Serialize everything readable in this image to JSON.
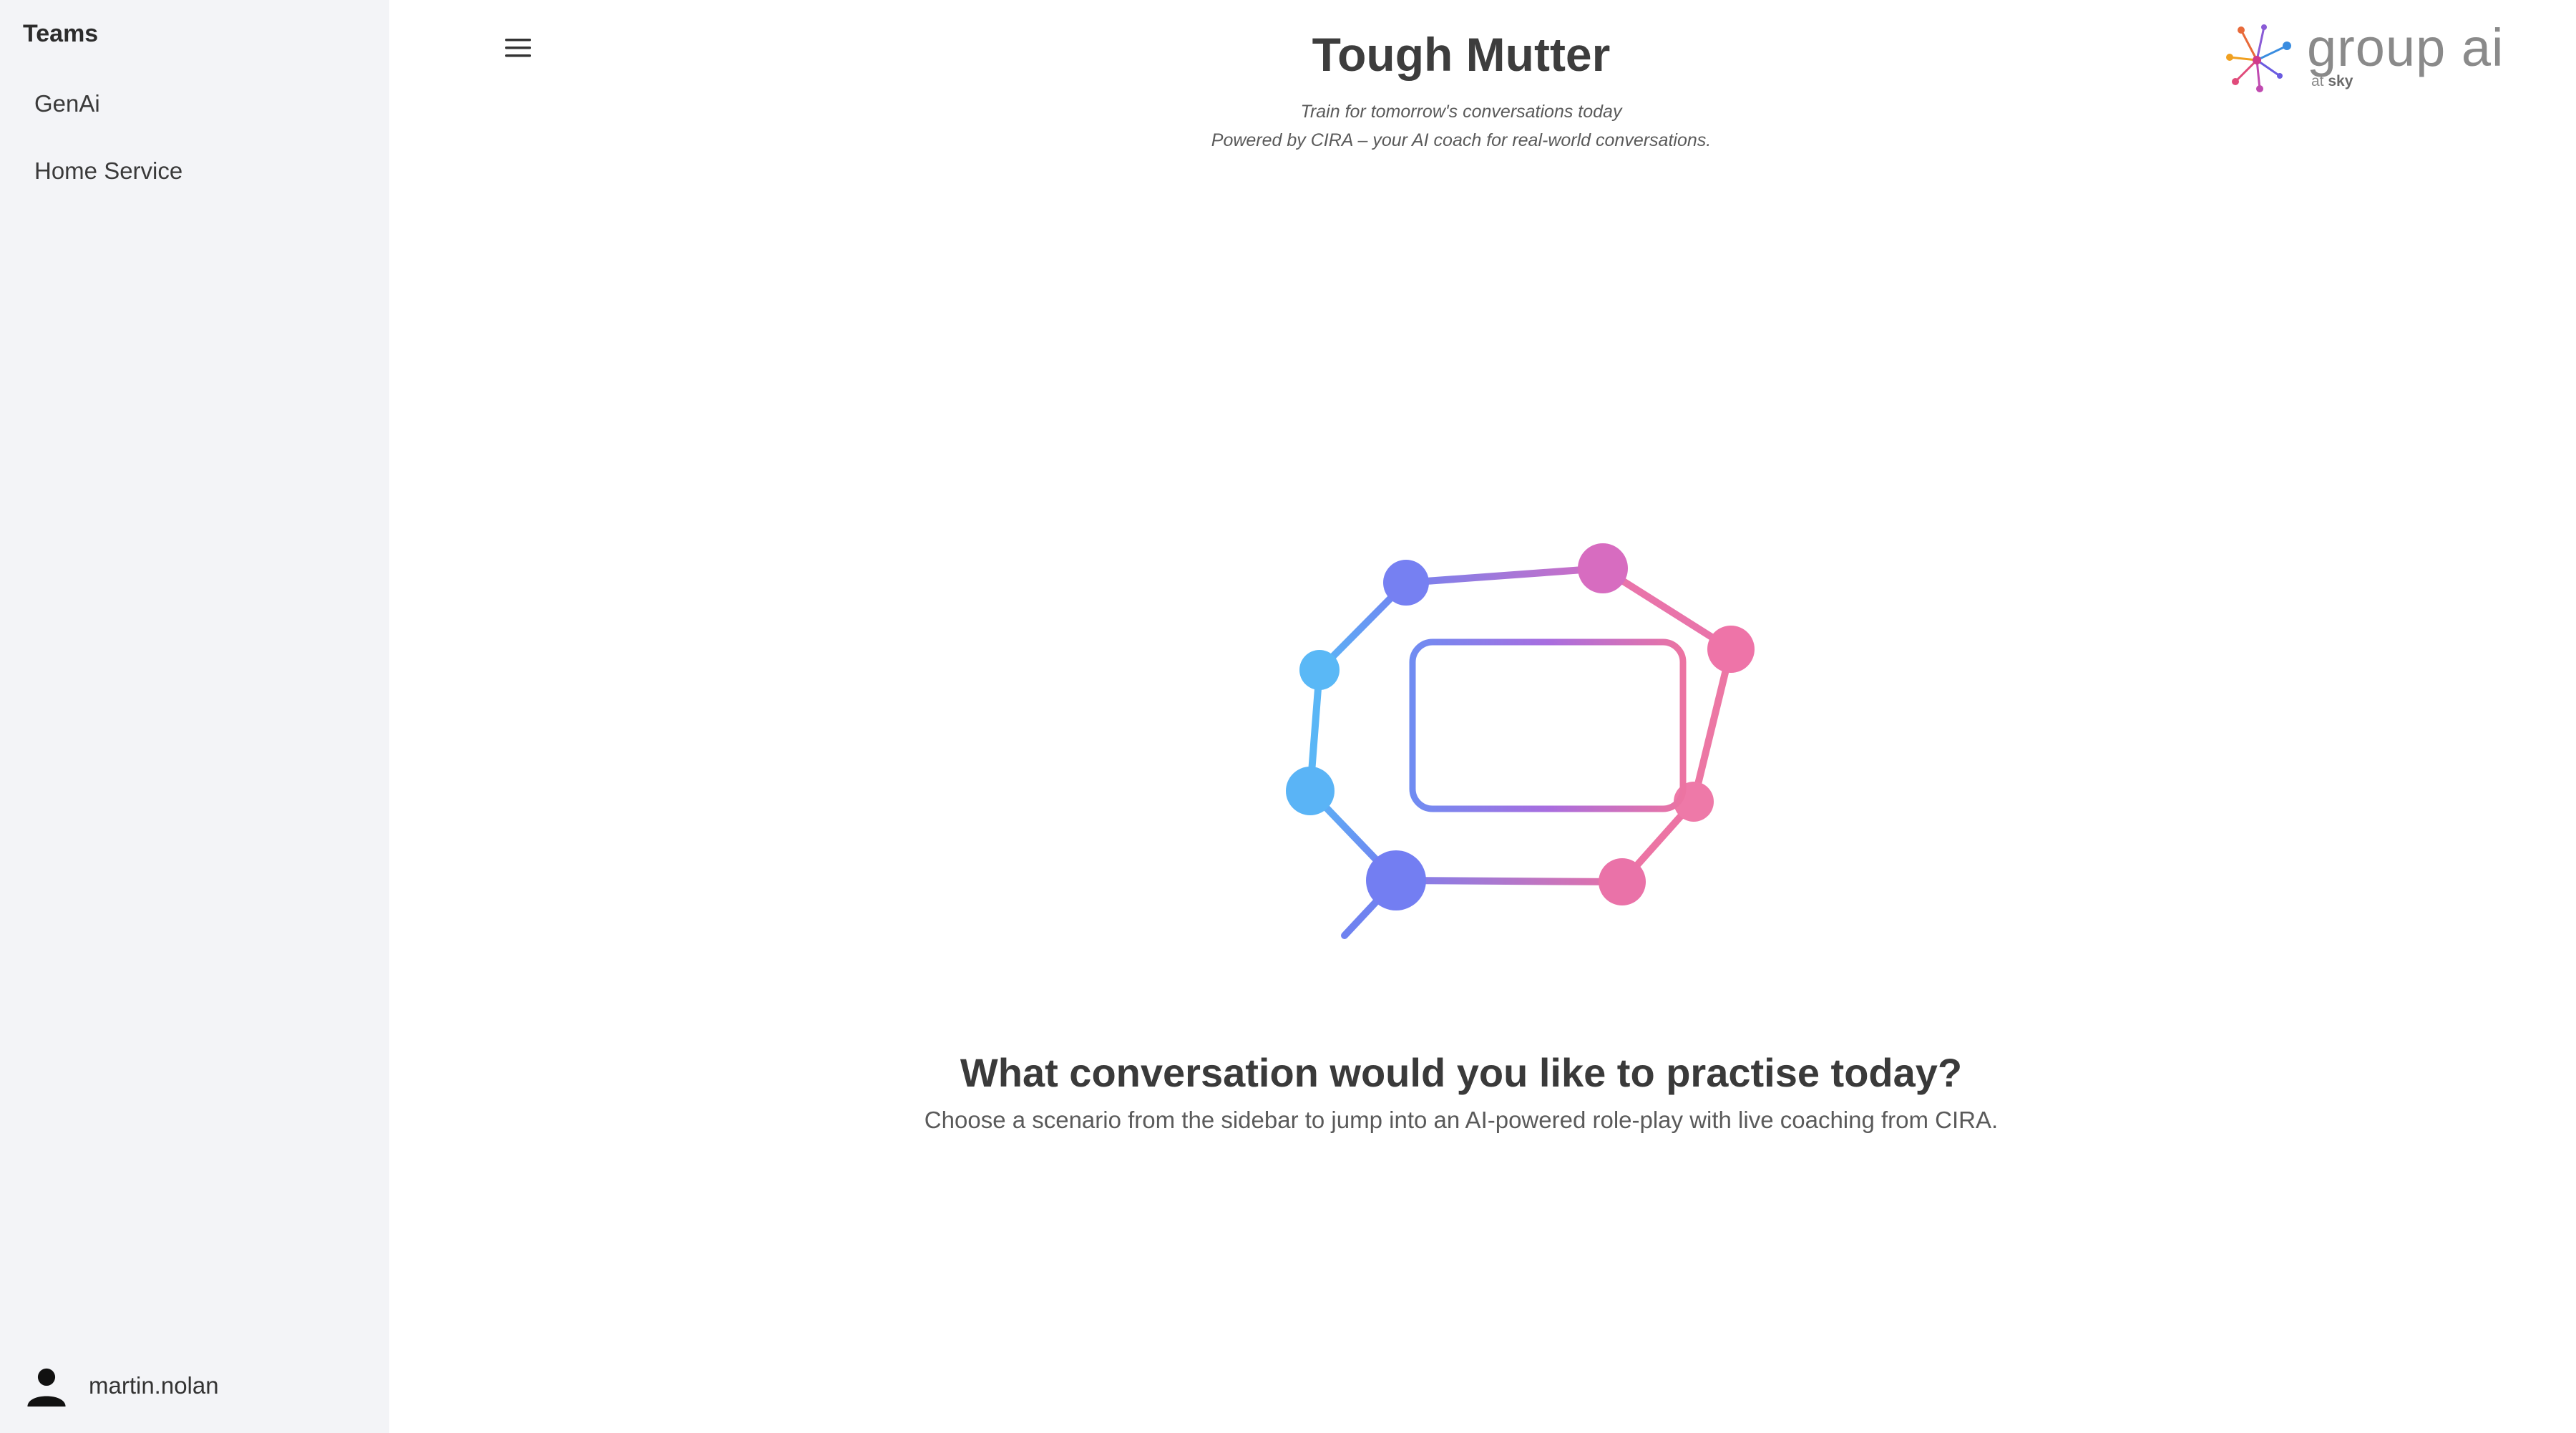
{
  "sidebar": {
    "heading": "Teams",
    "items": [
      {
        "label": "GenAi"
      },
      {
        "label": "Home Service"
      }
    ],
    "user": {
      "name": "martin.nolan"
    }
  },
  "header": {
    "title": "Tough Mutter",
    "tagline_1": "Train for tomorrow's conversations today",
    "tagline_2": "Powered by CIRA – your AI coach for real-world conversations."
  },
  "brand": {
    "name": "group ai",
    "sub_prefix": "at",
    "sub_brand": "sky"
  },
  "icons": {
    "menu": "hamburger-menu-icon",
    "user": "user-avatar-icon",
    "hero": "voice-network-illustration",
    "logo": "group-ai-logo-mark"
  },
  "colors": {
    "blue": "#5ab8f5",
    "indigo": "#6f7bf2",
    "purple": "#a66be0",
    "pink": "#ea6fa6"
  },
  "main": {
    "prompt_title": "What conversation would you like to practise today?",
    "prompt_subtitle": "Choose a scenario from the sidebar to jump into an AI-powered role-play with live coaching from CIRA."
  }
}
